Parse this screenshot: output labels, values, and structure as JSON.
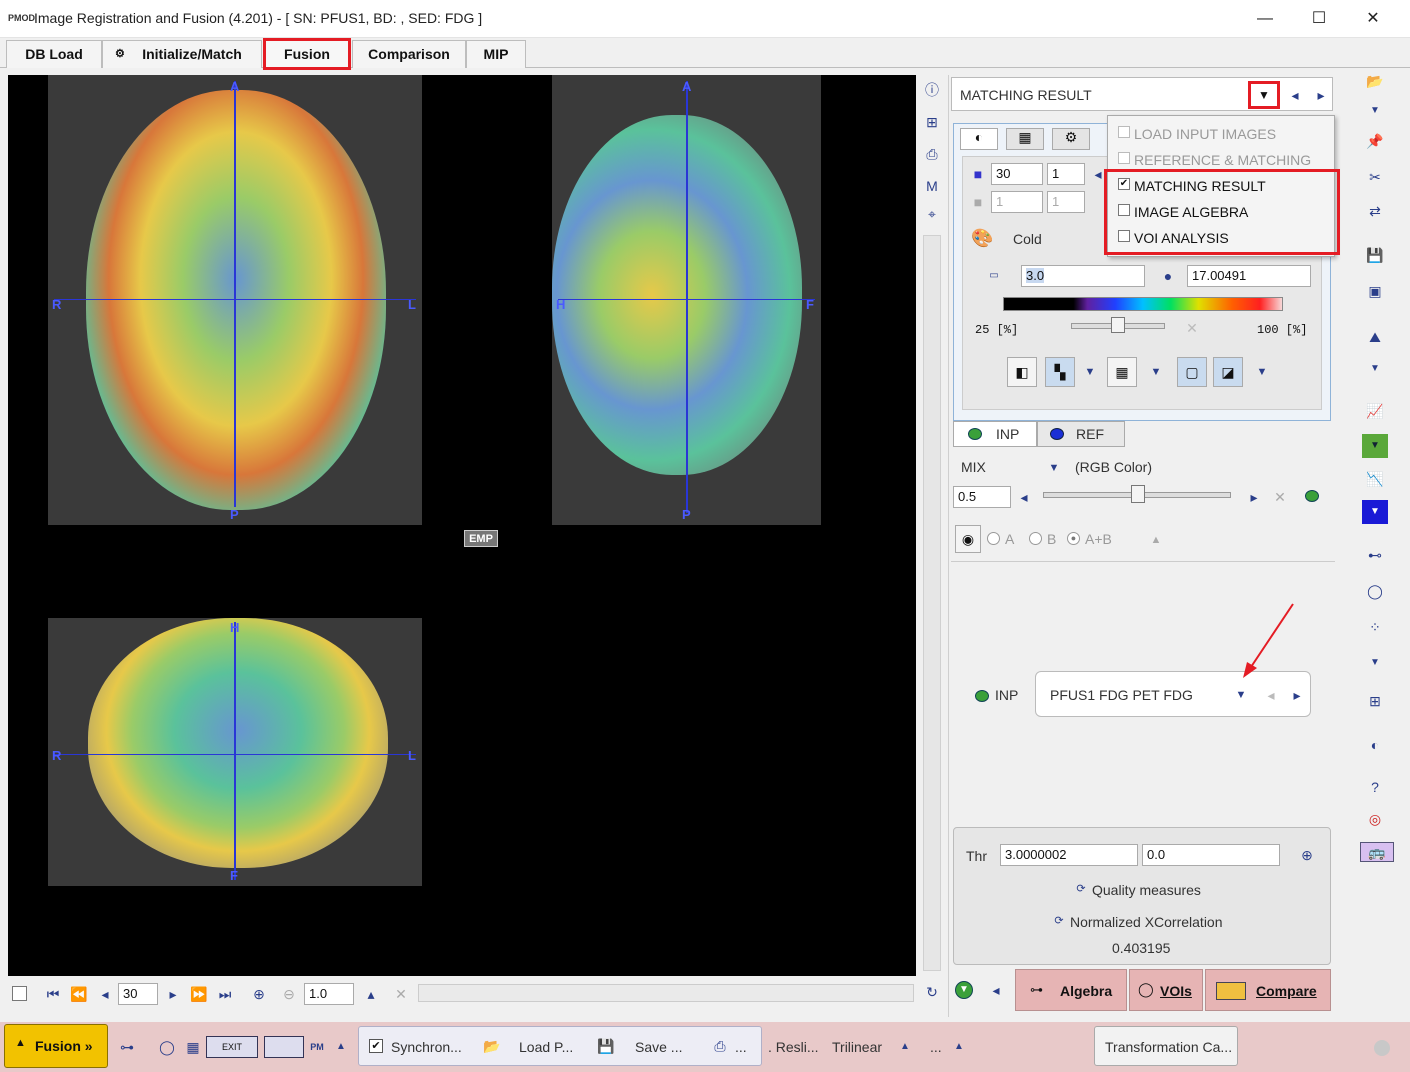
{
  "window": {
    "title": "Image Registration and Fusion (4.201) - [ SN: PFUS1, BD: , SED: FDG ]",
    "app_icon": "PMOD",
    "minimize": "—",
    "maximize": "☐",
    "close": "✕"
  },
  "tabs": [
    {
      "label": "DB Load"
    },
    {
      "label": "Initialize/Match"
    },
    {
      "label": "Fusion"
    },
    {
      "label": "Comparison"
    },
    {
      "label": "MIP"
    }
  ],
  "viewer": {
    "axial": {
      "top": "A",
      "bottom": "P",
      "left": "R",
      "right": "L"
    },
    "sagittal": {
      "top": "A",
      "bottom": "P",
      "left": "H",
      "right": "F"
    },
    "coronal": {
      "top": "H",
      "bottom": "F",
      "left": "R",
      "right": "L"
    },
    "emp_label": "EMP"
  },
  "viewer_toolbar": {
    "slice": "30",
    "zoom": "1.0"
  },
  "panel": {
    "selector_value": "MATCHING RESULT",
    "dropdown": [
      {
        "label": "LOAD INPUT IMAGES",
        "checked": false,
        "enabled": false
      },
      {
        "label": "REFERENCE & MATCHING",
        "checked": false,
        "enabled": false
      },
      {
        "label": "MATCHING RESULT",
        "checked": true,
        "enabled": true
      },
      {
        "label": "IMAGE ALGEBRA",
        "checked": false,
        "enabled": true
      },
      {
        "label": "VOI ANALYSIS",
        "checked": false,
        "enabled": true
      }
    ],
    "slice_a": "30",
    "slice_b": "1",
    "slice_c": "1",
    "slice_d": "1",
    "colormap": "Cold",
    "min_value": "3.0",
    "max_value": "17.00491",
    "pct_low": "25 [%]",
    "pct_high": "100 [%]",
    "series_tabs": [
      "INP",
      "REF"
    ],
    "mix_label": "MIX",
    "mix_mode": "(RGB Color)",
    "mix_value": "0.5",
    "radio_a": "A",
    "radio_b": "B",
    "radio_ab": "A+B",
    "inp_label": "INP",
    "inp_series": "PFUS1 FDG PET FDG",
    "thr_label": "Thr",
    "thr_a": "3.0000002",
    "thr_b": "0.0",
    "quality_label": "Quality measures",
    "ncc_label": "Normalized XCorrelation",
    "ncc_value": "0.403195",
    "algebra_btn": "Algebra",
    "vois_btn": "VOIs",
    "compare_btn": "Compare"
  },
  "bottombar": {
    "fusion_btn": "Fusion »",
    "synchron": "Synchron...",
    "load": "Load P...",
    "save": "Save ...",
    "print": "...",
    "reslice": ". Resli...",
    "interp": "Trilinear",
    "dots": "...",
    "transform": "Transformation Ca..."
  },
  "colors": {
    "accent_red": "#e41c24",
    "crosshair": "#2a36d6",
    "bottom_bg": "#e8c9c9",
    "yellow_btn": "#f2c200"
  }
}
